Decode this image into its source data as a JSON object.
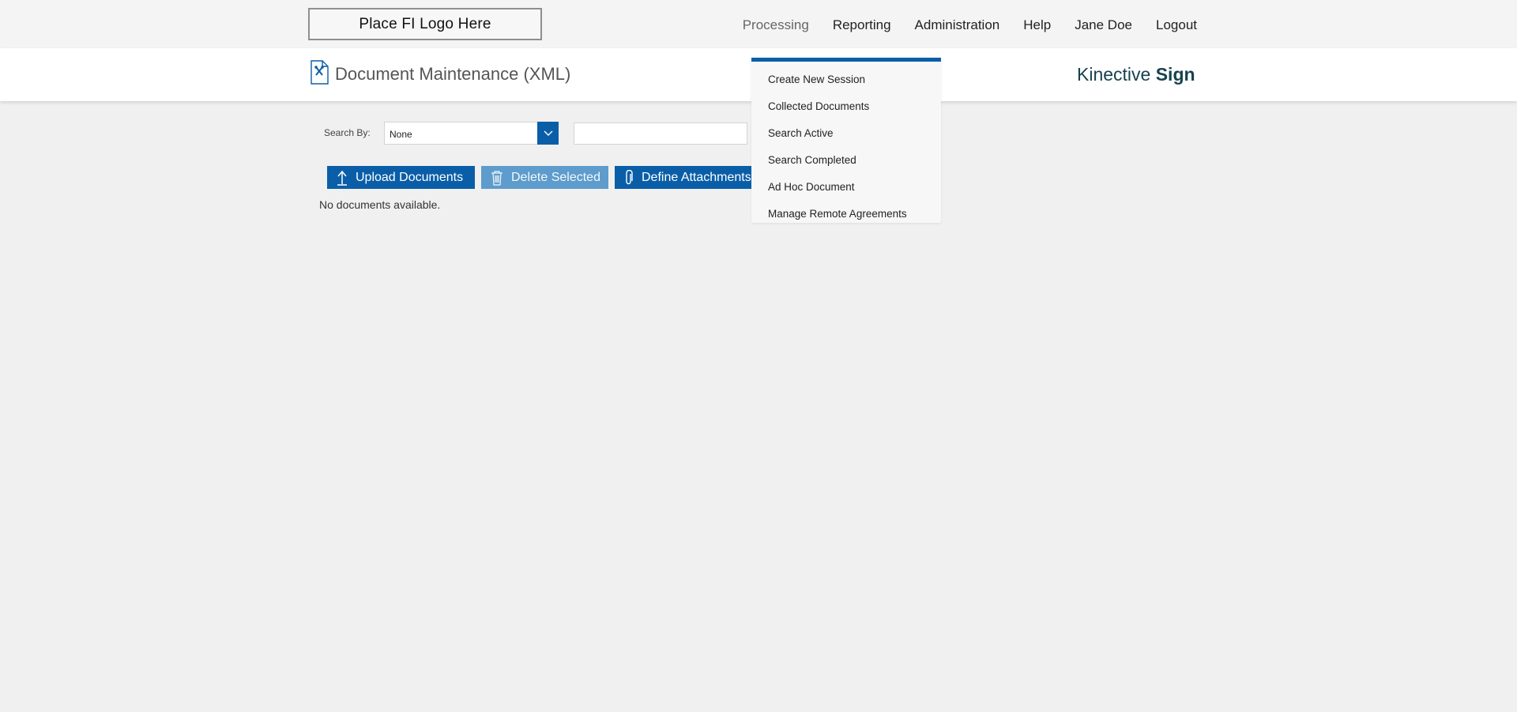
{
  "header": {
    "logo_text": "Place FI Logo Here",
    "nav": [
      "Processing",
      "Reporting",
      "Administration",
      "Help",
      "Jane Doe",
      "Logout"
    ]
  },
  "page": {
    "title": "Document Maintenance (XML)",
    "brand_light": "Kinective",
    "brand_bold": "Sign"
  },
  "search": {
    "label": "Search By:",
    "selected": "None",
    "value": ""
  },
  "toolbar": {
    "upload_label": "Upload Documents",
    "delete_label": "Delete Selected",
    "attach_label": "Define Attachments"
  },
  "main": {
    "empty_message": "No documents available."
  },
  "processing_menu": {
    "items": [
      "Create New Session",
      "Collected Documents",
      "Search Active",
      "Search Completed",
      "Ad Hoc Document",
      "Manage Remote Agreements"
    ]
  },
  "colors": {
    "accent": "#0a5ea8",
    "accent_disabled": "#5d9ccc",
    "brand": "#17424f",
    "page_bg": "#f0f0f0"
  },
  "icons": {
    "page_icon": "document-wrench-icon",
    "upload": "upload-arrow-icon",
    "delete": "trash-icon",
    "attach": "paperclip-icon",
    "select": "chevron-down-icon"
  }
}
